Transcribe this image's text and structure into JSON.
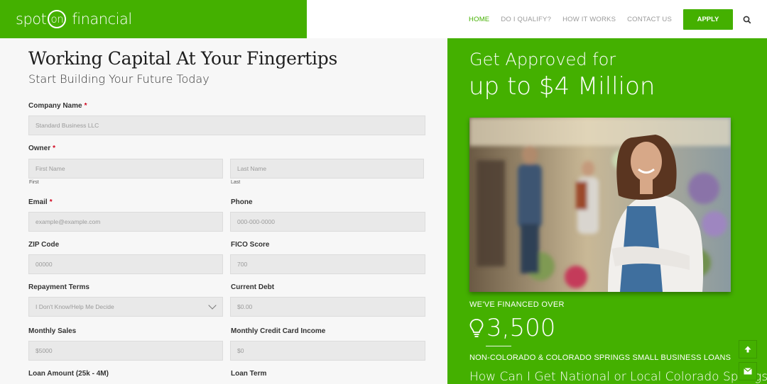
{
  "brand": {
    "logo_a": "spot",
    "logo_b": "on",
    "logo_c": "financial",
    "color": "#44b000"
  },
  "nav": {
    "items": [
      "HOME",
      "DO I QUALIFY?",
      "HOW IT WORKS",
      "CONTACT US"
    ],
    "apply": "APPLY",
    "search_icon": "search-icon"
  },
  "form": {
    "title": "Working Capital At Your Fingertips",
    "subtitle": "Start Building Your Future Today",
    "required_mark": "*",
    "company_label": "Company Name",
    "company_placeholder": "Standard Business LLC",
    "owner_label": "Owner",
    "first_placeholder": "First Name",
    "first_sub": "First",
    "last_placeholder": "Last Name",
    "last_sub": "Last",
    "email_label": "Email",
    "email_placeholder": "example@example.com",
    "phone_label": "Phone",
    "phone_placeholder": "000-000-0000",
    "zip_label": "ZIP Code",
    "zip_placeholder": "00000",
    "fico_label": "FICO Score",
    "fico_placeholder": "700",
    "terms_label": "Repayment Terms",
    "terms_value": "I Don't Know/Help Me Decide",
    "debt_label": "Current Debt",
    "debt_placeholder": "$0.00",
    "sales_label": "Monthly Sales",
    "sales_placeholder": "$5000",
    "cc_label": "Monthly Credit Card Income",
    "cc_placeholder": "$0",
    "loan_amount_label": "Loan Amount (25k - 4M)",
    "loan_term_label": "Loan Term"
  },
  "promo": {
    "line1": "Get Approved for",
    "line2": "up to $4 Million",
    "financed_label": "WE'VE FINANCED OVER",
    "count": "3,500",
    "count_icon": "lightbulb-icon",
    "loans_label": "NON-COLORADO & COLORADO SPRINGS SMALL BUSINESS LOANS",
    "question": "How Can I Get National or Local Colorado Springs"
  },
  "floating": {
    "top": "arrow-up-icon",
    "mail": "mail-icon"
  }
}
